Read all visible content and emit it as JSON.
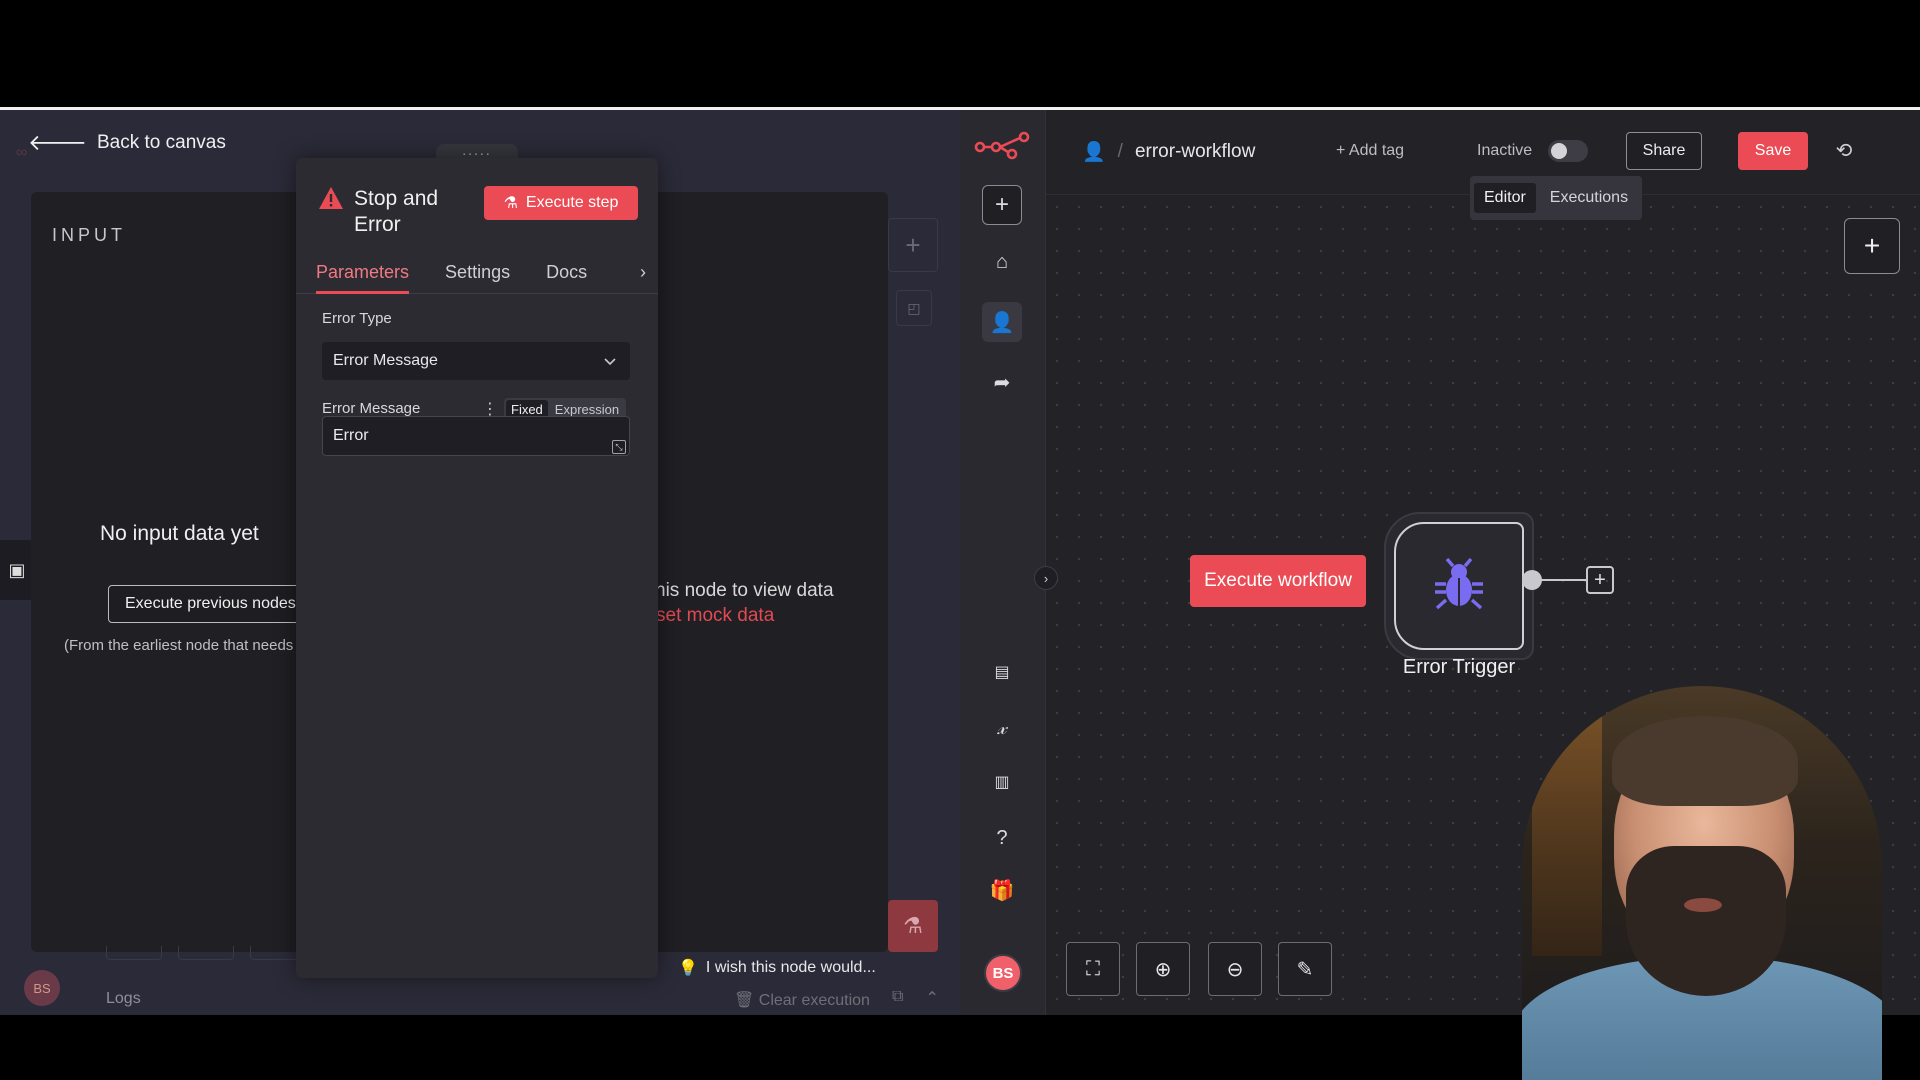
{
  "left": {
    "back_label": "Back to canvas",
    "input": {
      "title": "INPUT",
      "empty_text": "No input data yet",
      "exec_prev_label": "Execute previous nodes",
      "hint": "(From the earliest node that needs it)"
    },
    "output": {
      "text1": "his node to view data",
      "text2": "set mock data"
    },
    "wish": "I wish this node would...",
    "logs": "Logs",
    "clear_exec": "Clear execution",
    "avatar_ghost": "BS"
  },
  "dialog": {
    "title": "Stop and Error",
    "execute_step": "Execute step",
    "tabs": [
      {
        "label": "Parameters",
        "active": true
      },
      {
        "label": "Settings",
        "active": false
      },
      {
        "label": "Docs",
        "active": false
      }
    ],
    "error_type_label": "Error Type",
    "error_type_value": "Error Message",
    "error_message_label": "Error Message",
    "mode_fixed": "Fixed",
    "mode_expression": "Expression",
    "error_message_value": "Error"
  },
  "right": {
    "workflow_name": "error-workflow",
    "add_tag": "+ Add tag",
    "inactive_label": "Inactive",
    "share": "Share",
    "save": "Save",
    "view_tabs": [
      {
        "label": "Editor",
        "active": true
      },
      {
        "label": "Executions",
        "active": false
      }
    ],
    "execute_workflow": "Execute workflow",
    "node_label": "Error Trigger",
    "avatar": "BS",
    "accent": "#ea4b55",
    "node_icon_color": "#7a6cf0"
  }
}
